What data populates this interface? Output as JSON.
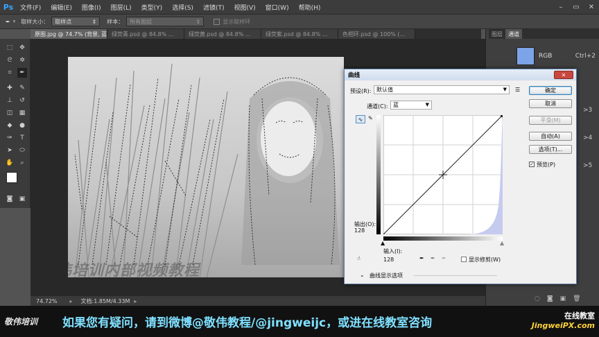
{
  "menubar": {
    "logo": "Ps",
    "items": [
      "文件(F)",
      "编辑(E)",
      "图像(I)",
      "图层(L)",
      "类型(Y)",
      "选择(S)",
      "滤镜(T)",
      "视图(V)",
      "窗口(W)",
      "帮助(H)"
    ]
  },
  "options": {
    "sample_size_label": "取样大小：",
    "sample_size_value": "取样点",
    "sample_label": "样本：",
    "sample_value": "所有图层",
    "show_ring_label": "显示取样环"
  },
  "tabs": [
    "原图.jpg @ 74.7% (背景, 蓝/8) *",
    "绿荧青.psd @ 84.8% ...",
    "绿荧黄.psd @ 84.8% ...",
    "绿荧紫.psd @ 84.8% ...",
    "色相环.psd @ 100% (..."
  ],
  "status": {
    "zoom": "74.72%",
    "doc": "文档:1.85M/4.33M"
  },
  "panels": {
    "tab1": "图层",
    "tab2": "通道",
    "rgb_label": "RGB",
    "rgb_shortcut": "Ctrl+2",
    "right_edge": [
      ">3",
      ">4",
      ">5"
    ]
  },
  "dialog": {
    "title": "曲线",
    "preset_label": "预设(R):",
    "preset_value": "默认值",
    "channel_label": "通道(C):",
    "channel_value": "蓝",
    "output_label": "输出(O):",
    "output_value": "128",
    "input_label": "输入(I):",
    "input_value": "128",
    "show_clipping": "显示修剪(W)",
    "curve_display": "曲线显示选项",
    "buttons": [
      "确定",
      "取消",
      "平滑(M)",
      "自动(A)",
      "选项(T)..."
    ],
    "preview_label": "预览(P)"
  },
  "footer": {
    "brand": "敬伟培训",
    "message": "如果您有疑问，请到微博@敬伟教程/@jingweijc，或进在线教室咨询",
    "site_top": "在线教室",
    "site_bottom": "JingweiPX.com"
  },
  "watermark": "敬伟培训内部视频教程"
}
